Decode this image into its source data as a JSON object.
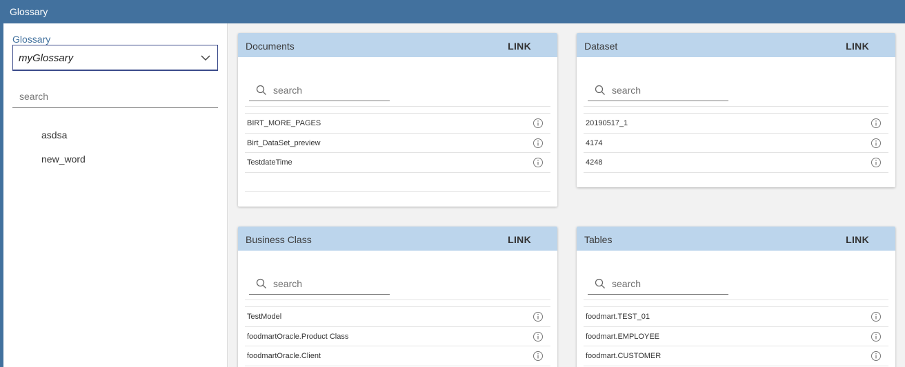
{
  "app": {
    "title": "Glossary"
  },
  "sidebar": {
    "label": "Glossary",
    "select_value": "myGlossary",
    "search_placeholder": "search",
    "words": [
      "asdsa",
      "new_word"
    ]
  },
  "cards": {
    "documents": {
      "title": "Documents",
      "link": "LINK",
      "search_placeholder": "search",
      "rows": [
        "BIRT_MORE_PAGES",
        "Birt_DataSet_preview",
        "TestdateTime"
      ]
    },
    "dataset": {
      "title": "Dataset",
      "link": "LINK",
      "search_placeholder": "search",
      "rows": [
        "20190517_1",
        "4174",
        "4248"
      ]
    },
    "business_class": {
      "title": "Business Class",
      "link": "LINK",
      "search_placeholder": "search",
      "rows": [
        "TestModel",
        "foodmartOracle.Product Class",
        "foodmartOracle.Client"
      ]
    },
    "tables": {
      "title": "Tables",
      "link": "LINK",
      "search_placeholder": "search",
      "rows": [
        "foodmart.TEST_01",
        "foodmart.EMPLOYEE",
        "foodmart.CUSTOMER"
      ]
    }
  },
  "colors": {
    "topbar": "#42719e",
    "card_header": "#bcd5ec",
    "main_bg": "#f2f2f2"
  }
}
